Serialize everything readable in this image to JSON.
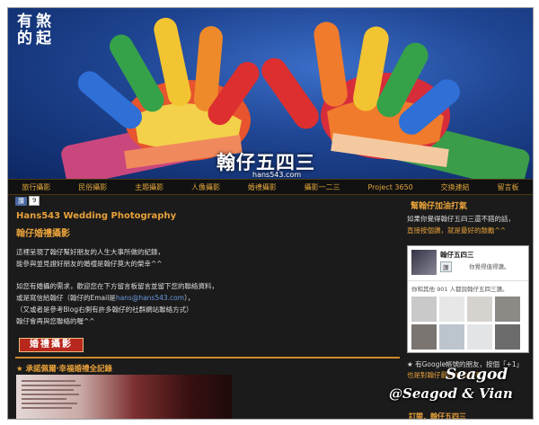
{
  "header": {
    "logo_chars": [
      "有",
      "煞",
      "的",
      "起"
    ],
    "title": "翰仔五四三",
    "subtitle": "hans543.com"
  },
  "nav": {
    "items": [
      "旅行攝影",
      "民俗攝影",
      "主題攝影",
      "人像攝影",
      "婚禮攝影",
      "攝影一二三",
      "Project 3650",
      "交換連結",
      "留言板"
    ]
  },
  "likebar": {
    "button": "讚",
    "count": "9"
  },
  "post": {
    "title": "Hans543 Wedding Photography",
    "subtitle": "翰仔婚禮攝影",
    "line1": "這裡呈現了翰仔幫好朋友的人生大事所做的紀錄，",
    "line2": "能參與並見證好朋友的婚禮是翰仔莫大的榮幸^^",
    "line3": "如您有婚攝的需求，歡迎您在下方留言板留言並留下您的聯絡資料，",
    "line4_pre": "或是寫信給翰仔（翰仔的Email是",
    "line4_link": "hans@hans543.com",
    "line4_post": "），",
    "line5": "（又或者是參考Blog右側有許多翰仔的社群網站聯絡方式）",
    "line6": "翰仔會再與您聯絡的喔^^",
    "stamp": "婚禮攝影",
    "section_heading": "★ 承諾佩爾‧幸福婚禮全記錄"
  },
  "sidebar": {
    "title": "幫翰仔加油打氣",
    "text1": "如果你覺得翰仔五四三還不錯的話，",
    "text2": "直接按個讚，就是最好的鼓勵^^",
    "fb_page_name": "翰仔五四三",
    "fb_like": "讚",
    "fb_like_msg": "你覺得值得讚。",
    "fb_count": "你和其他 901 人都說翰仔五四三讚。",
    "note1": "★ 有Google帳號的朋友，按個「+1」",
    "note2": "也是對翰仔最好的鼓勵喔^^/......",
    "footer": "訂閱．翰仔五四三"
  },
  "watermark": {
    "line1": "Seagod",
    "line2": "@Seagod & Vian"
  },
  "colors": {
    "accent": "#e8a13a",
    "background": "#1b1b1b",
    "link": "#6b9be0",
    "stamp": "#b8281e"
  }
}
